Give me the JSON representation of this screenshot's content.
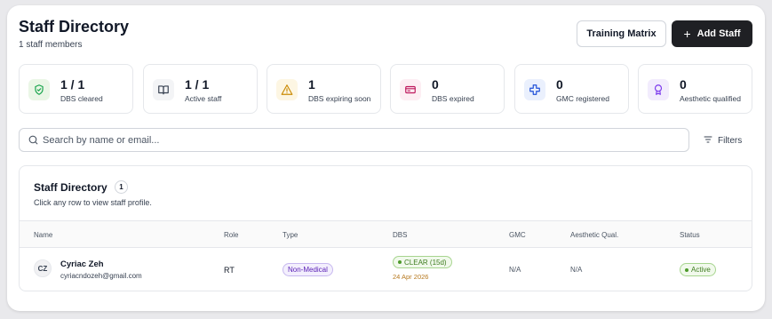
{
  "header": {
    "title": "Staff Directory",
    "subtitle": "1 staff members",
    "training_matrix_label": "Training Matrix",
    "add_staff_label": "Add Staff"
  },
  "stats": [
    {
      "value": "1 / 1",
      "label": "DBS cleared",
      "icon": "shield-check-icon",
      "color": "#16a34a",
      "bg": "#eaf6e6"
    },
    {
      "value": "1 / 1",
      "label": "Active staff",
      "icon": "book-open-icon",
      "color": "#374151",
      "bg": "#f3f4f6"
    },
    {
      "value": "1",
      "label": "DBS expiring soon",
      "icon": "warning-icon",
      "color": "#ca8a04",
      "bg": "#fdf6e3"
    },
    {
      "value": "0",
      "label": "DBS expired",
      "icon": "card-icon",
      "color": "#be185d",
      "bg": "#fdeef3"
    },
    {
      "value": "0",
      "label": "GMC registered",
      "icon": "medical-cross-icon",
      "color": "#1d4ed8",
      "bg": "#eaf0fd"
    },
    {
      "value": "0",
      "label": "Aesthetic qualified",
      "icon": "award-icon",
      "color": "#7c3aed",
      "bg": "#f2ecfd"
    }
  ],
  "search": {
    "placeholder": "Search by name or email..."
  },
  "filters_label": "Filters",
  "table": {
    "title": "Staff Directory",
    "count": "1",
    "subtitle": "Click any row to view staff profile.",
    "columns": [
      "Name",
      "Role",
      "Type",
      "DBS",
      "GMC",
      "Aesthetic Qual.",
      "Status"
    ],
    "rows": [
      {
        "initials": "CZ",
        "name": "Cyriac Zeh",
        "email": "cyriacndozeh@gmail.com",
        "role": "RT",
        "type": "Non-Medical",
        "dbs_status": "CLEAR (15d)",
        "dbs_date": "24 Apr 2026",
        "gmc": "N/A",
        "aesthetic": "N/A",
        "status": "Active"
      }
    ]
  }
}
